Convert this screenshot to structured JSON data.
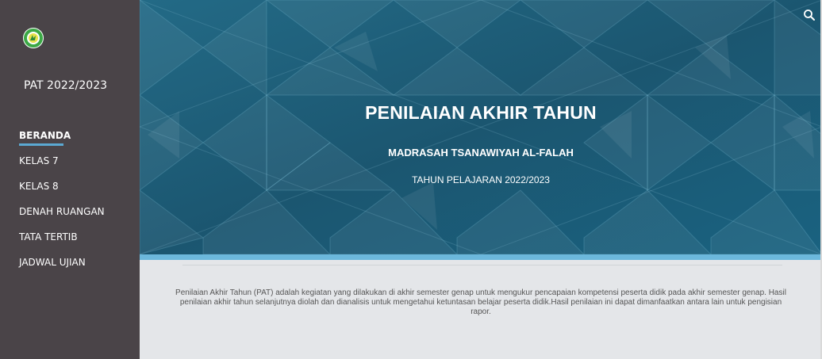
{
  "sidebar": {
    "logo_icon": "school-emblem-icon",
    "site_title": "PAT 2022/2023",
    "items": [
      {
        "label": "BERANDA",
        "active": true
      },
      {
        "label": "KELAS 7"
      },
      {
        "label": "KELAS 8"
      },
      {
        "label": "DENAH RUANGAN"
      },
      {
        "label": "TATA TERTIB"
      },
      {
        "label": "JADWAL UJIAN"
      }
    ]
  },
  "hero": {
    "title": "PENILAIAN AKHIR TAHUN",
    "subtitle": "MADRASAH TSANAWIYAH AL-FALAH",
    "year": "TAHUN PELAJARAN 2022/2023",
    "search_icon": "search-icon"
  },
  "content": {
    "description": "Penilaian Akhir Tahun (PAT) adalah kegiatan yang dilakukan di akhir semester genap untuk mengukur pencapaian kompetensi peserta didik pada akhir semester genap. Hasil penilaian akhir tahun selanjutnya diolah dan dianalisis untuk mengetahui ketuntasan belajar peserta didik.Hasil penilaian ini dapat dimanfaatkan antara lain untuk pengisian rapor."
  },
  "colors": {
    "sidebar_bg": "#4a4448",
    "hero_bg": "#1d5f7c",
    "accent": "#6cb8dc",
    "content_bg": "#e4e6e9"
  }
}
